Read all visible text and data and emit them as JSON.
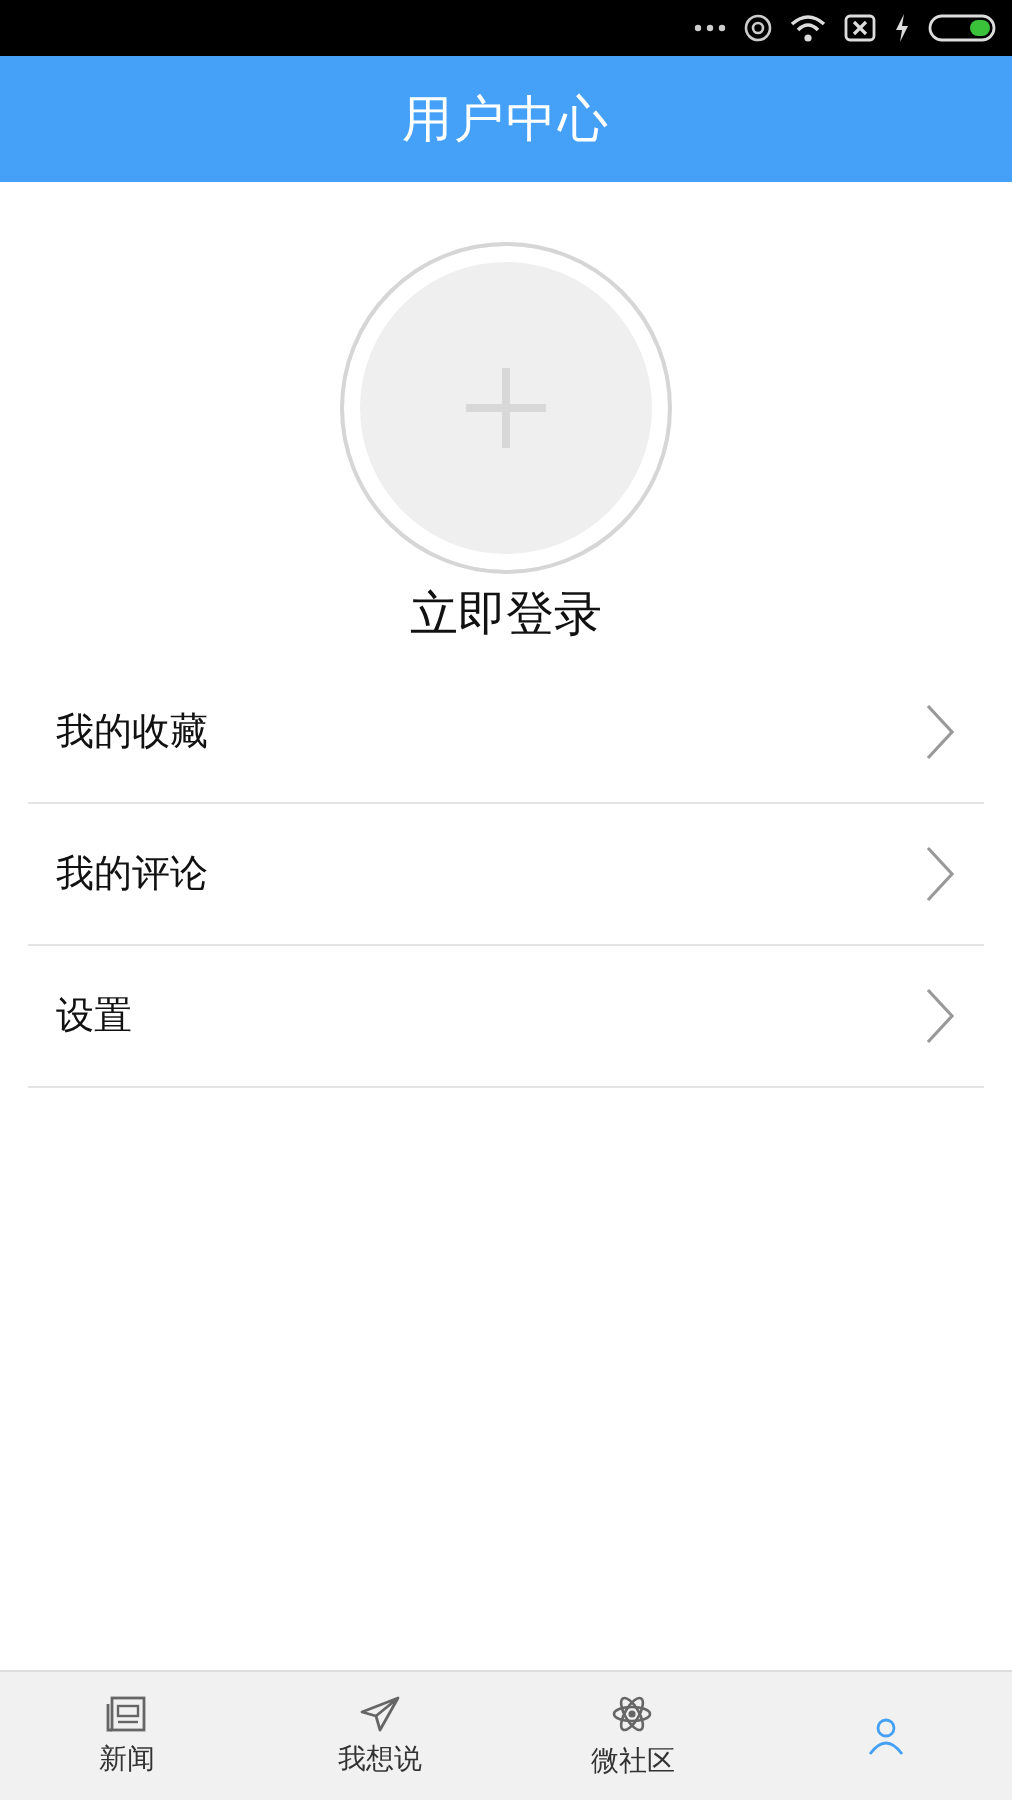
{
  "header": {
    "title": "用户中心"
  },
  "profile": {
    "login_label": "立即登录"
  },
  "menu": [
    {
      "label": "我的收藏"
    },
    {
      "label": "我的评论"
    },
    {
      "label": "设置"
    }
  ],
  "tabs": [
    {
      "label": "新闻",
      "kind": "news",
      "selected": false
    },
    {
      "label": "我想说",
      "kind": "post",
      "selected": false
    },
    {
      "label": "微社区",
      "kind": "community",
      "selected": false
    },
    {
      "kind": "profile",
      "selected": true
    }
  ]
}
